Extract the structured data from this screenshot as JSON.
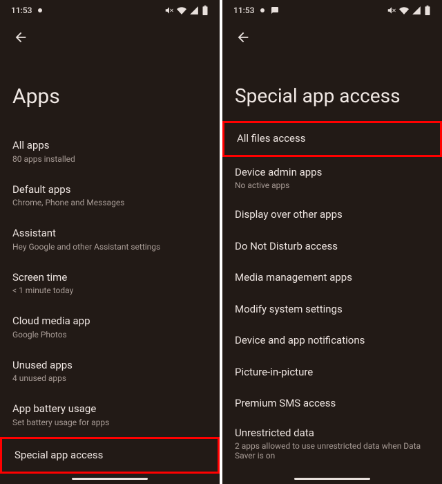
{
  "status": {
    "time": "11:53"
  },
  "left": {
    "title": "Apps",
    "items": [
      {
        "title": "All apps",
        "sub": "80 apps installed"
      },
      {
        "title": "Default apps",
        "sub": "Chrome, Phone and Messages"
      },
      {
        "title": "Assistant",
        "sub": "Hey Google and other Assistant settings"
      },
      {
        "title": "Screen time",
        "sub": "< 1 minute today"
      },
      {
        "title": "Cloud media app",
        "sub": "Google Photos"
      },
      {
        "title": "Unused apps",
        "sub": "4 unused apps"
      },
      {
        "title": "App battery usage",
        "sub": "Set battery usage for apps"
      },
      {
        "title": "Special app access",
        "sub": ""
      }
    ]
  },
  "right": {
    "title": "Special app access",
    "items": [
      {
        "title": "All files access",
        "sub": ""
      },
      {
        "title": "Device admin apps",
        "sub": "No active apps"
      },
      {
        "title": "Display over other apps",
        "sub": ""
      },
      {
        "title": "Do Not Disturb access",
        "sub": ""
      },
      {
        "title": "Media management apps",
        "sub": ""
      },
      {
        "title": "Modify system settings",
        "sub": ""
      },
      {
        "title": "Device and app notifications",
        "sub": ""
      },
      {
        "title": "Picture-in-picture",
        "sub": ""
      },
      {
        "title": "Premium SMS access",
        "sub": ""
      },
      {
        "title": "Unrestricted data",
        "sub": "2 apps allowed to use unrestricted data when Data Saver is on"
      }
    ]
  }
}
